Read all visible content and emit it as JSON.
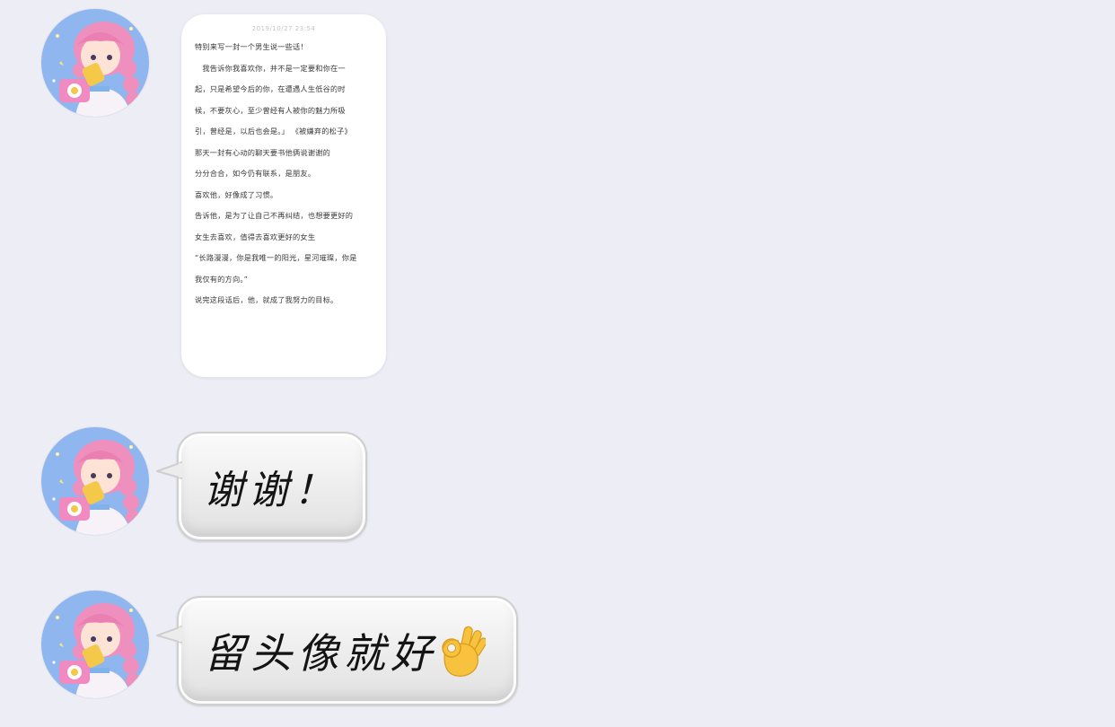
{
  "messages": [
    {
      "type": "image",
      "timestamp": "2019/10/27 23:54",
      "lines": [
        "特别来写一封一个男生说一些话！",
        "　我告诉你我喜欢你，并不是一定要和你在一",
        "起，只是希望今后的你，在遭遇人生低谷的时",
        "候，不要灰心，至少曾经有人被你的魅力所吸",
        "引，曾经是，以后也会是。」 《被嫌弃的松子》",
        "那天一封有心动的聊天要书他俩说谢谢的",
        "分分合合，如今仍有联系，是朋友。",
        "喜欢他，好像成了习惯。",
        "告诉他，是为了让自己不再纠结，也想要更好的",
        "女生去喜欢，值得去喜欢更好的女生",
        "“长路漫漫，你是我唯一的阳光，星河璀璨，你是",
        "我仅有的方向。”",
        "说完这段话后，他，就成了我努力的目标。"
      ]
    },
    {
      "type": "text",
      "text": "谢谢！"
    },
    {
      "type": "text",
      "text": "留头像就好",
      "emoji": "ok-hand-icon"
    }
  ],
  "colors": {
    "background": "#ededf5",
    "bubble_border": "#cfcfcf",
    "avatar_bg": "#8fb6ef",
    "avatar_hair": "#ee8fbd"
  }
}
